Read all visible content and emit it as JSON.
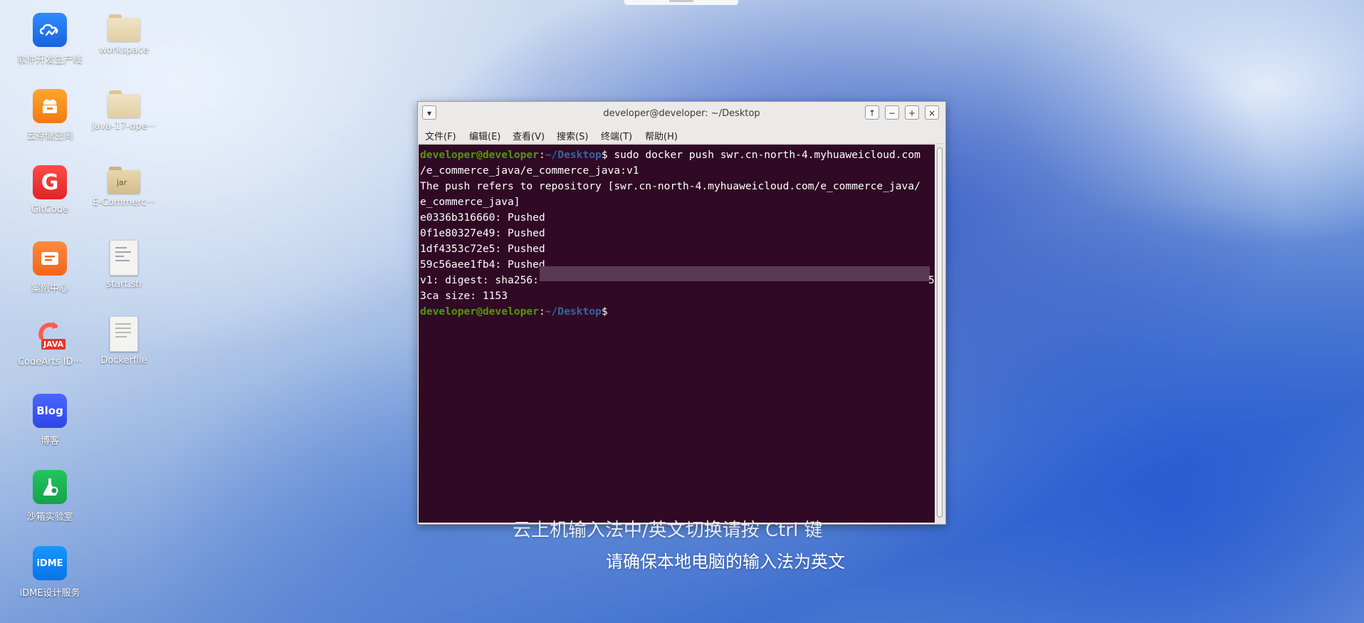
{
  "desktop": {
    "icons": [
      {
        "label": "软件开发生产线",
        "icon": "cloud-devops-icon"
      },
      {
        "label": "workspace",
        "icon": "folder-icon"
      },
      {
        "label": "云存储空间",
        "icon": "cloud-storage-icon"
      },
      {
        "label": "java-17-ope···",
        "icon": "folder-icon"
      },
      {
        "label": "GitCode",
        "icon": "gitcode-icon",
        "glyph": "G"
      },
      {
        "label": "E-Commerc···",
        "icon": "jar-icon",
        "glyph": "jar"
      },
      {
        "label": "案例中心",
        "icon": "case-center-icon"
      },
      {
        "label": "start.sh",
        "icon": "script-file-icon"
      },
      {
        "label": "CodeArts ID···",
        "icon": "java-ide-icon",
        "glyph": "JAVA"
      },
      {
        "label": "Dockerfile",
        "icon": "text-file-icon"
      },
      {
        "label": "博客",
        "icon": "blog-icon",
        "glyph": "Blog"
      },
      {
        "label": "沙箱实验室",
        "icon": "sandbox-lab-icon"
      },
      {
        "label": "iDME设计服务",
        "icon": "idme-icon",
        "glyph": "iDME"
      }
    ]
  },
  "terminal": {
    "title": "developer@developer: ~/Desktop",
    "buttons": {
      "menu": "▾",
      "up": "↑",
      "minimize": "−",
      "maximize": "+",
      "close": "×"
    },
    "menu": [
      "文件(F)",
      "编辑(E)",
      "查看(V)",
      "搜索(S)",
      "终端(T)",
      "帮助(H)"
    ],
    "prompt_user": "developer@developer",
    "prompt_sep": ":",
    "prompt_path": "~/Desktop",
    "prompt_dollar": "$",
    "command": " sudo docker push swr.cn-north-4.myhuaweicloud.com",
    "lines": [
      "/e_commerce_java/e_commerce_java:v1",
      "The push refers to repository [swr.cn-north-4.myhuaweicloud.com/e_commerce_java/",
      "e_commerce_java]",
      "e0336b316660: Pushed",
      "0f1e80327e49: Pushed",
      "1df4353c72e5: Pushed",
      "59c56aee1fb4: Pushed",
      "v1: digest: sha256:",
      "3ca size: 1153"
    ],
    "digest_tail": "5"
  },
  "overlay": {
    "line1": "云上机输入法中/英文切换请按 Ctrl 键",
    "line2": "请确保本地电脑的输入法为英文"
  }
}
